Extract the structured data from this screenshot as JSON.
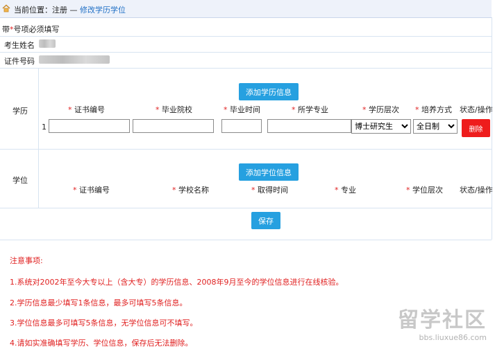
{
  "breadcrumb": {
    "prefix": "当前位置：注册 — ",
    "current": "修改学历学位"
  },
  "required_note": {
    "prefix": "带",
    "star": "*",
    "suffix": "号项必须填写"
  },
  "fields": {
    "name_label": "考生姓名",
    "id_label": "证件号码"
  },
  "education": {
    "section_label": "学历",
    "add_button": "添加学历信息",
    "columns": [
      {
        "star": "*",
        "label": "证书编号"
      },
      {
        "star": "*",
        "label": "毕业院校"
      },
      {
        "star": "*",
        "label": "毕业时间"
      },
      {
        "star": "*",
        "label": "所学专业"
      },
      {
        "star": "*",
        "label": "学历层次"
      },
      {
        "star": "*",
        "label": "培养方式"
      }
    ],
    "status_col": "状态",
    "action_col": "操作",
    "row_index": "1",
    "row": {
      "cert_no": "",
      "school": "",
      "grad_time": "",
      "major": "",
      "level": "博士研究生",
      "mode": "全日制",
      "delete_button": "删除"
    }
  },
  "degree": {
    "section_label": "学位",
    "add_button": "添加学位信息",
    "columns": [
      {
        "star": "*",
        "label": "证书编号"
      },
      {
        "star": "*",
        "label": "学校名称"
      },
      {
        "star": "*",
        "label": "取得时间"
      },
      {
        "star": "*",
        "label": "专业"
      },
      {
        "star": "*",
        "label": "学位层次"
      }
    ],
    "status_col": "状态",
    "action_col": "操作"
  },
  "save_button": "保存",
  "notes": {
    "title": "注意事项:",
    "items": [
      "1.系统对2002年至今大专以上（含大专）的学历信息、2008年9月至今的学位信息进行在线核验。",
      "2.学历信息最少填写1条信息，最多可填写5条信息。",
      "3.学位信息最多可填写5条信息，无学位信息可不填写。",
      "4.请如实准确填写学历、学位信息，保存后无法删除。"
    ]
  },
  "watermark": {
    "main": "留学社区",
    "sub": "bbs.liuxue86.com"
  }
}
